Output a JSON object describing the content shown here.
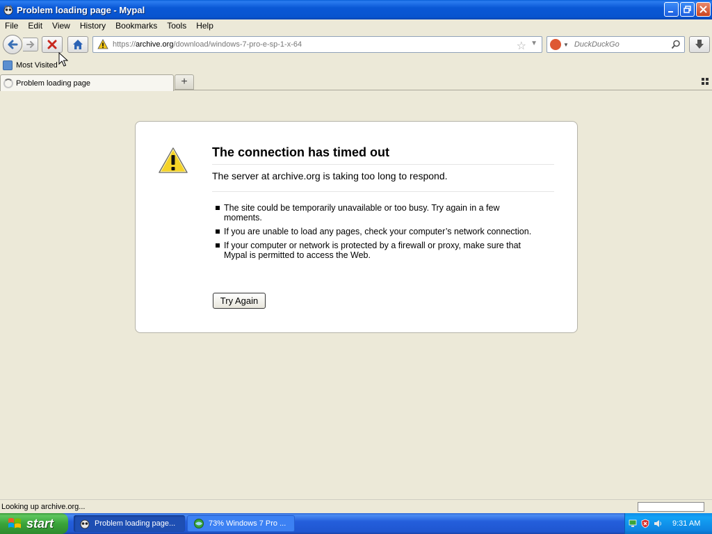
{
  "window": {
    "title": "Problem loading page - Mypal"
  },
  "menu": [
    {
      "label": "File"
    },
    {
      "label": "Edit"
    },
    {
      "label": "View"
    },
    {
      "label": "History"
    },
    {
      "label": "Bookmarks"
    },
    {
      "label": "Tools"
    },
    {
      "label": "Help"
    }
  ],
  "navbar": {
    "url_scheme": "https://",
    "url_host": "archive.org",
    "url_path": "/download/windows-7-pro-e-sp-1-x-64",
    "search_placeholder": "DuckDuckGo"
  },
  "bookmarks": {
    "most_visited": "Most Visited"
  },
  "tabs": [
    {
      "label": "Problem loading page"
    }
  ],
  "error": {
    "title": "The connection has timed out",
    "description": "The server at archive.org is taking too long to respond.",
    "bullets": [
      "The site could be temporarily unavailable or too busy. Try again in a few moments.",
      "If you are unable to load any pages, check your computer’s network connection.",
      "If your computer or network is protected by a firewall or proxy, make sure that Mypal is permitted to access the Web."
    ],
    "button": "Try Again"
  },
  "status": {
    "text": "Looking up archive.org..."
  },
  "taskbar": {
    "start": "start",
    "tasks": [
      {
        "label": "Problem loading page..."
      },
      {
        "label": "73% Windows 7 Pro ..."
      }
    ],
    "clock": "9:31 AM"
  },
  "colors": {
    "titlebar": "#0a58d6",
    "error_box_bg": "#ffffff",
    "content_bg": "#ece9d8",
    "taskbar": "#245edb",
    "start_button": "#3aa43a"
  },
  "icons": {
    "app": "mypal-app-icon",
    "warning": "warning-triangle-icon",
    "back": "back-arrow-icon",
    "forward": "forward-arrow-icon",
    "stop": "stop-x-icon",
    "home": "home-icon",
    "bookmark_star": "star-icon",
    "search": "magnifier-icon",
    "download": "download-arrow-icon"
  }
}
